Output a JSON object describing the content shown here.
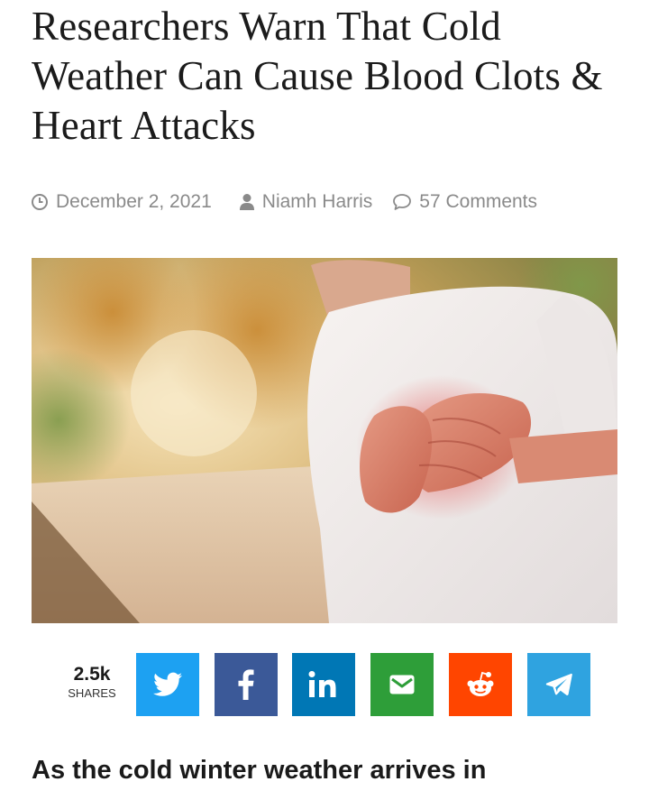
{
  "article": {
    "title": "Researchers Warn That Cold Weather Can Cause Blood Clots & Heart Attacks",
    "lead": "As the cold winter weather arrives in"
  },
  "meta": {
    "date": "December 2, 2021",
    "author": "Niamh Harris",
    "comments": "57 Comments",
    "icons": [
      "clock-icon",
      "user-icon",
      "comment-icon"
    ]
  },
  "hero_image": {
    "alt": ""
  },
  "share": {
    "count": "2.5k",
    "count_label": "SHARES",
    "buttons": [
      {
        "network": "twitter",
        "icon": "twitter-icon",
        "color": "#1da1f2"
      },
      {
        "network": "facebook",
        "icon": "facebook-icon",
        "color": "#3b5998",
        "glyph": "f"
      },
      {
        "network": "linkedin",
        "icon": "linkedin-icon",
        "color": "#0077b5",
        "glyph": "in"
      },
      {
        "network": "email",
        "icon": "email-icon",
        "color": "#2e9e39"
      },
      {
        "network": "reddit",
        "icon": "reddit-icon",
        "color": "#ff4500"
      },
      {
        "network": "telegram",
        "icon": "telegram-icon",
        "color": "#2fa3e0"
      }
    ]
  },
  "colors": {
    "meta_text": "#8a8a8a",
    "headline": "#1b1b1b"
  }
}
